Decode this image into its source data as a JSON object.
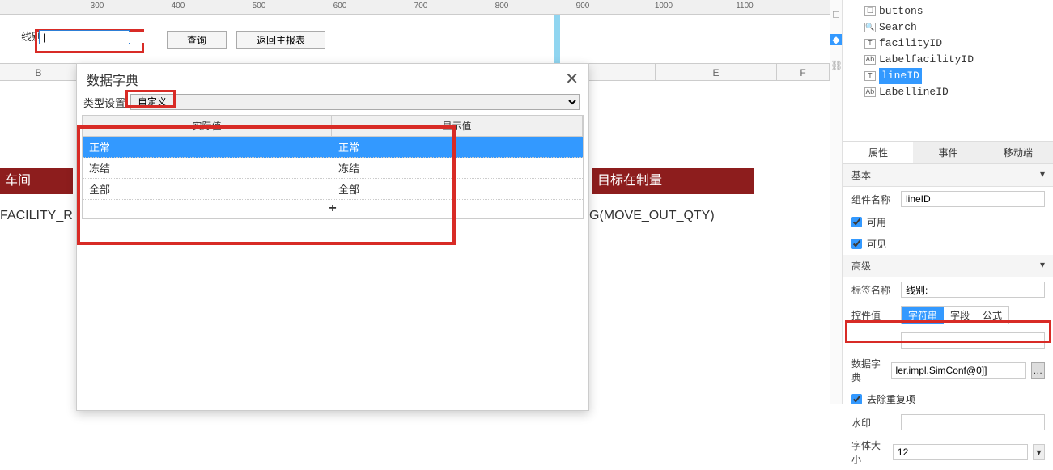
{
  "ruler": [
    "300",
    "400",
    "500",
    "600",
    "700",
    "800",
    "900",
    "1000",
    "1100"
  ],
  "form": {
    "line_label": "线别:",
    "query": "查询",
    "back": "返回主报表"
  },
  "cols": [
    "B",
    "E",
    "F"
  ],
  "band1": "车间",
  "band2": "目标在制量",
  "under1": "FACILITY_R",
  "under2": "G(MOVE_OUT_QTY)",
  "modal": {
    "title": "数据字典",
    "type_label": "类型设置",
    "type_value": "自定义",
    "head_actual": "实际值",
    "head_display": "显示值",
    "rows": [
      {
        "actual": "正常",
        "display": "正常"
      },
      {
        "actual": "冻结",
        "display": "冻结"
      },
      {
        "actual": "全部",
        "display": "全部"
      }
    ],
    "add": "+"
  },
  "tree": {
    "items": [
      {
        "icon": "btn",
        "label": "buttons"
      },
      {
        "icon": "srch",
        "label": "Search"
      },
      {
        "icon": "txt",
        "label": "facilityID"
      },
      {
        "icon": "lbl",
        "label": "LabelfacilityID"
      },
      {
        "icon": "txt",
        "label": "lineID",
        "sel": true
      },
      {
        "icon": "lbl",
        "label": "LabellineID"
      }
    ]
  },
  "tabs": {
    "prop": "属性",
    "event": "事件",
    "mobile": "移动端"
  },
  "sect_basic": "基本",
  "sect_adv": "高级",
  "props": {
    "comp_name_label": "组件名称",
    "comp_name": "lineID",
    "enable": "可用",
    "visible": "可见",
    "lbl_name_label": "标签名称",
    "lbl_name": "线别:",
    "ctrl_val": "控件值",
    "v_str": "字符串",
    "v_field": "字段",
    "v_formula": "公式",
    "dict_label": "数据字典",
    "dict_value": "ler.impl.SimConf@0]]",
    "dedupe": "去除重复项",
    "watermark": "水印",
    "font_size_label": "字体大小",
    "font_size": "12"
  }
}
